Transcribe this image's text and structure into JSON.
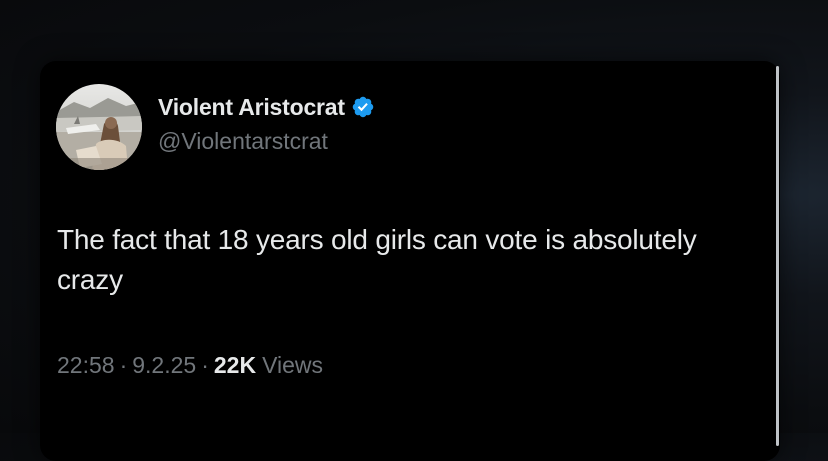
{
  "tweet": {
    "author": {
      "display_name": "Violent Aristocrat",
      "handle": "@Violentarstcrat",
      "verified": true,
      "verified_color": "#1d9bf0"
    },
    "text": "The fact that 18 years old girls can vote is absolutely crazy",
    "time": "22:58",
    "separator": "·",
    "date": "9.2.25",
    "views_count": "22K",
    "views_label": "Views"
  },
  "colors": {
    "card_background": "#000000",
    "primary_text": "#e7e9ea",
    "secondary_text": "#71767b"
  }
}
